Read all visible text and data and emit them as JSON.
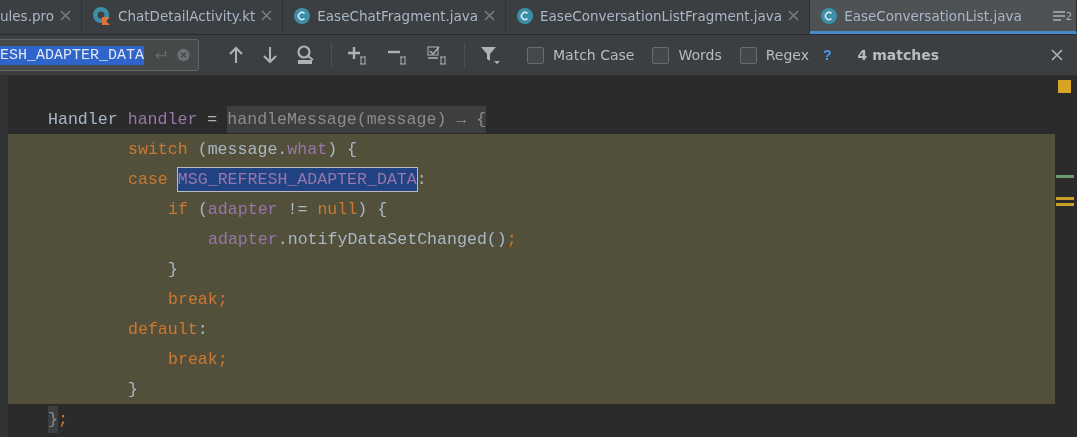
{
  "tabs": [
    {
      "label": "ules.pro",
      "kind": "plain",
      "selected": false,
      "closable": true
    },
    {
      "label": "ChatDetailActivity.kt",
      "kind": "kotlin",
      "selected": false,
      "closable": true
    },
    {
      "label": "EaseChatFragment.java",
      "kind": "class",
      "selected": false,
      "closable": true
    },
    {
      "label": "EaseConversationListFragment.java",
      "kind": "class",
      "selected": false,
      "closable": true
    },
    {
      "label": "EaseConversationList.java",
      "kind": "class",
      "selected": true,
      "closable": false
    }
  ],
  "hidden_tabs_count": "2",
  "search": {
    "value": "ESH_ADAPTER_DATA",
    "options": [
      {
        "label": "Match Case",
        "checked": false
      },
      {
        "label": "Words",
        "checked": false
      },
      {
        "label": "Regex",
        "checked": false
      }
    ],
    "help": "?",
    "result": "4 matches"
  },
  "code": {
    "lines": [
      {
        "highlighted": false,
        "tokens": [
          {
            "kind": "plain",
            "text": "Handler "
          },
          {
            "kind": "field",
            "text": "handler"
          },
          {
            "kind": "plain",
            "text": " = "
          },
          {
            "kind": "folded",
            "text": "handleMessage(message) → {"
          }
        ],
        "children": [
          {
            "highlighted": true,
            "tokens": [
              {
                "kind": "keyword",
                "text": "switch"
              },
              {
                "kind": "plain",
                "text": " (message."
              },
              {
                "kind": "field",
                "text": "what"
              },
              {
                "kind": "plain",
                "text": ") {"
              }
            ]
          },
          {
            "highlighted": true,
            "tokens": [
              {
                "kind": "keyword",
                "text": "case "
              },
              {
                "kind": "match",
                "text": "MSG_REFRESH_ADAPTER_DATA"
              },
              {
                "kind": "plain",
                "text": ":"
              }
            ],
            "children": [
              {
                "highlighted": true,
                "tokens": [
                  {
                    "kind": "keyword",
                    "text": "if"
                  },
                  {
                    "kind": "plain",
                    "text": " ("
                  },
                  {
                    "kind": "field",
                    "text": "adapter"
                  },
                  {
                    "kind": "plain",
                    "text": " != "
                  },
                  {
                    "kind": "keyword",
                    "text": "null"
                  },
                  {
                    "kind": "plain",
                    "text": ") {"
                  }
                ],
                "children": [
                  {
                    "highlighted": true,
                    "tokens": [
                      {
                        "kind": "field",
                        "text": "adapter"
                      },
                      {
                        "kind": "plain",
                        "text": ".notifyDataSetChanged()"
                      },
                      {
                        "kind": "keyword",
                        "text": ";"
                      }
                    ]
                  }
                ]
              },
              {
                "highlighted": true,
                "tokens": [
                  {
                    "kind": "plain",
                    "text": "}"
                  }
                ]
              },
              {
                "highlighted": true,
                "tokens": [
                  {
                    "kind": "keyword",
                    "text": "break;"
                  }
                ]
              }
            ]
          },
          {
            "highlighted": true,
            "tokens": [
              {
                "kind": "keyword",
                "text": "default"
              },
              {
                "kind": "plain",
                "text": ":"
              }
            ],
            "children": [
              {
                "highlighted": true,
                "tokens": [
                  {
                    "kind": "keyword",
                    "text": "break;"
                  }
                ]
              }
            ]
          },
          {
            "highlighted": true,
            "tokens": [
              {
                "kind": "plain",
                "text": "}"
              }
            ]
          }
        ]
      },
      {
        "highlighted": false,
        "tokens": [
          {
            "kind": "folded",
            "text": "}"
          },
          {
            "kind": "keyword",
            "text": ";"
          }
        ]
      }
    ]
  }
}
